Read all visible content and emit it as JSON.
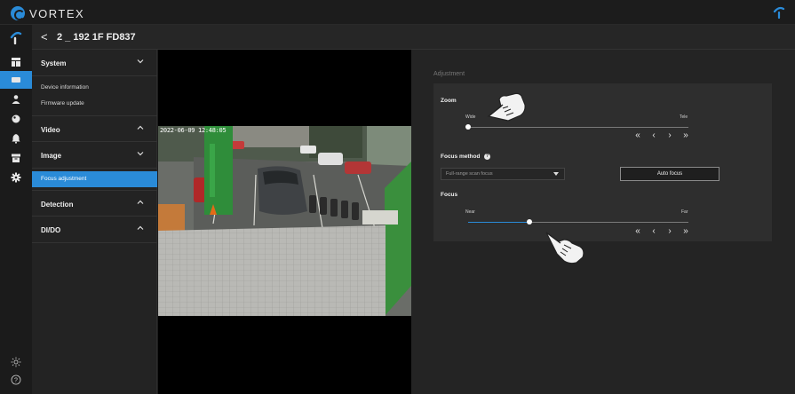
{
  "app": {
    "brand": "VORTEX",
    "accent": "#2a8bd8"
  },
  "header": {
    "back_glyph": "<",
    "device_title": "2 _ 192 1F FD837"
  },
  "rail": {
    "items": [
      {
        "icon": "vortex-logo-icon"
      },
      {
        "icon": "dashboard-icon"
      },
      {
        "icon": "camera-settings-icon",
        "active": true
      },
      {
        "icon": "user-icon"
      },
      {
        "icon": "tag-icon"
      },
      {
        "icon": "bell-icon"
      },
      {
        "icon": "archive-icon"
      },
      {
        "icon": "gear-icon"
      }
    ],
    "bottom": [
      {
        "icon": "brightness-icon"
      },
      {
        "icon": "help-icon"
      }
    ]
  },
  "menu": {
    "sections": [
      {
        "label": "System",
        "expanded": true,
        "items": [
          "Device information",
          "Firmware update"
        ]
      },
      {
        "label": "Video",
        "expanded": false
      },
      {
        "label": "Image",
        "expanded": true,
        "items": [
          "Focus adjustment"
        ],
        "active_item": "Focus adjustment"
      },
      {
        "label": "Detection",
        "expanded": false
      },
      {
        "label": "DI/DO",
        "expanded": false
      }
    ]
  },
  "video": {
    "timestamp": "2022-06-09 12:48:05"
  },
  "adjustment": {
    "title": "Adjustment",
    "zoom": {
      "label": "Zoom",
      "min_label": "Wide",
      "max_label": "Tele",
      "value": 0.0
    },
    "focus_method": {
      "label": "Focus method",
      "info_glyph": "?",
      "selected": "Full-range scan focus",
      "button": "Auto focus"
    },
    "focus": {
      "label": "Focus",
      "min_label": "Near",
      "max_label": "Far",
      "value": 0.28
    },
    "stepper": [
      "«",
      "‹",
      "›",
      "»"
    ]
  }
}
